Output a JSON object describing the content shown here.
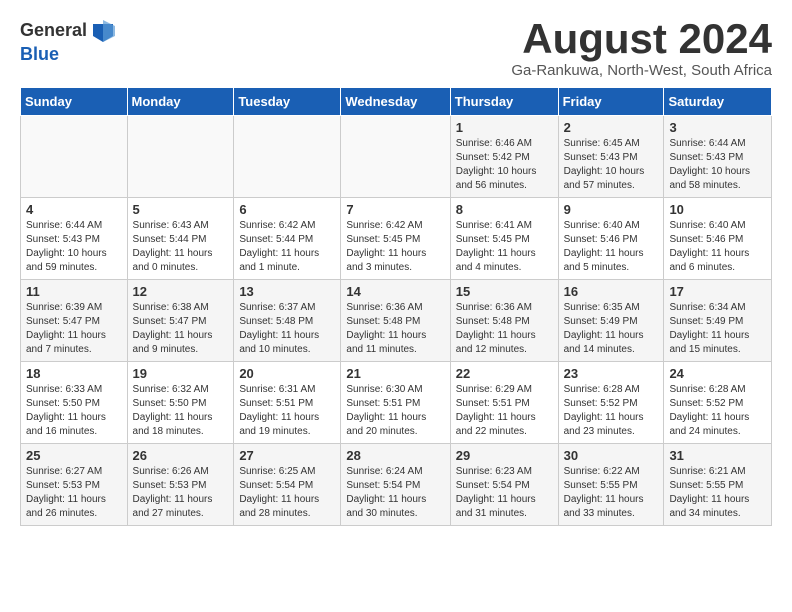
{
  "logo": {
    "general": "General",
    "blue": "Blue"
  },
  "title": "August 2024",
  "subtitle": "Ga-Rankuwa, North-West, South Africa",
  "days_of_week": [
    "Sunday",
    "Monday",
    "Tuesday",
    "Wednesday",
    "Thursday",
    "Friday",
    "Saturday"
  ],
  "weeks": [
    [
      {
        "day": "",
        "info": ""
      },
      {
        "day": "",
        "info": ""
      },
      {
        "day": "",
        "info": ""
      },
      {
        "day": "",
        "info": ""
      },
      {
        "day": "1",
        "info": "Sunrise: 6:46 AM\nSunset: 5:42 PM\nDaylight: 10 hours\nand 56 minutes."
      },
      {
        "day": "2",
        "info": "Sunrise: 6:45 AM\nSunset: 5:43 PM\nDaylight: 10 hours\nand 57 minutes."
      },
      {
        "day": "3",
        "info": "Sunrise: 6:44 AM\nSunset: 5:43 PM\nDaylight: 10 hours\nand 58 minutes."
      }
    ],
    [
      {
        "day": "4",
        "info": "Sunrise: 6:44 AM\nSunset: 5:43 PM\nDaylight: 10 hours\nand 59 minutes."
      },
      {
        "day": "5",
        "info": "Sunrise: 6:43 AM\nSunset: 5:44 PM\nDaylight: 11 hours\nand 0 minutes."
      },
      {
        "day": "6",
        "info": "Sunrise: 6:42 AM\nSunset: 5:44 PM\nDaylight: 11 hours\nand 1 minute."
      },
      {
        "day": "7",
        "info": "Sunrise: 6:42 AM\nSunset: 5:45 PM\nDaylight: 11 hours\nand 3 minutes."
      },
      {
        "day": "8",
        "info": "Sunrise: 6:41 AM\nSunset: 5:45 PM\nDaylight: 11 hours\nand 4 minutes."
      },
      {
        "day": "9",
        "info": "Sunrise: 6:40 AM\nSunset: 5:46 PM\nDaylight: 11 hours\nand 5 minutes."
      },
      {
        "day": "10",
        "info": "Sunrise: 6:40 AM\nSunset: 5:46 PM\nDaylight: 11 hours\nand 6 minutes."
      }
    ],
    [
      {
        "day": "11",
        "info": "Sunrise: 6:39 AM\nSunset: 5:47 PM\nDaylight: 11 hours\nand 7 minutes."
      },
      {
        "day": "12",
        "info": "Sunrise: 6:38 AM\nSunset: 5:47 PM\nDaylight: 11 hours\nand 9 minutes."
      },
      {
        "day": "13",
        "info": "Sunrise: 6:37 AM\nSunset: 5:48 PM\nDaylight: 11 hours\nand 10 minutes."
      },
      {
        "day": "14",
        "info": "Sunrise: 6:36 AM\nSunset: 5:48 PM\nDaylight: 11 hours\nand 11 minutes."
      },
      {
        "day": "15",
        "info": "Sunrise: 6:36 AM\nSunset: 5:48 PM\nDaylight: 11 hours\nand 12 minutes."
      },
      {
        "day": "16",
        "info": "Sunrise: 6:35 AM\nSunset: 5:49 PM\nDaylight: 11 hours\nand 14 minutes."
      },
      {
        "day": "17",
        "info": "Sunrise: 6:34 AM\nSunset: 5:49 PM\nDaylight: 11 hours\nand 15 minutes."
      }
    ],
    [
      {
        "day": "18",
        "info": "Sunrise: 6:33 AM\nSunset: 5:50 PM\nDaylight: 11 hours\nand 16 minutes."
      },
      {
        "day": "19",
        "info": "Sunrise: 6:32 AM\nSunset: 5:50 PM\nDaylight: 11 hours\nand 18 minutes."
      },
      {
        "day": "20",
        "info": "Sunrise: 6:31 AM\nSunset: 5:51 PM\nDaylight: 11 hours\nand 19 minutes."
      },
      {
        "day": "21",
        "info": "Sunrise: 6:30 AM\nSunset: 5:51 PM\nDaylight: 11 hours\nand 20 minutes."
      },
      {
        "day": "22",
        "info": "Sunrise: 6:29 AM\nSunset: 5:51 PM\nDaylight: 11 hours\nand 22 minutes."
      },
      {
        "day": "23",
        "info": "Sunrise: 6:28 AM\nSunset: 5:52 PM\nDaylight: 11 hours\nand 23 minutes."
      },
      {
        "day": "24",
        "info": "Sunrise: 6:28 AM\nSunset: 5:52 PM\nDaylight: 11 hours\nand 24 minutes."
      }
    ],
    [
      {
        "day": "25",
        "info": "Sunrise: 6:27 AM\nSunset: 5:53 PM\nDaylight: 11 hours\nand 26 minutes."
      },
      {
        "day": "26",
        "info": "Sunrise: 6:26 AM\nSunset: 5:53 PM\nDaylight: 11 hours\nand 27 minutes."
      },
      {
        "day": "27",
        "info": "Sunrise: 6:25 AM\nSunset: 5:54 PM\nDaylight: 11 hours\nand 28 minutes."
      },
      {
        "day": "28",
        "info": "Sunrise: 6:24 AM\nSunset: 5:54 PM\nDaylight: 11 hours\nand 30 minutes."
      },
      {
        "day": "29",
        "info": "Sunrise: 6:23 AM\nSunset: 5:54 PM\nDaylight: 11 hours\nand 31 minutes."
      },
      {
        "day": "30",
        "info": "Sunrise: 6:22 AM\nSunset: 5:55 PM\nDaylight: 11 hours\nand 33 minutes."
      },
      {
        "day": "31",
        "info": "Sunrise: 6:21 AM\nSunset: 5:55 PM\nDaylight: 11 hours\nand 34 minutes."
      }
    ]
  ]
}
